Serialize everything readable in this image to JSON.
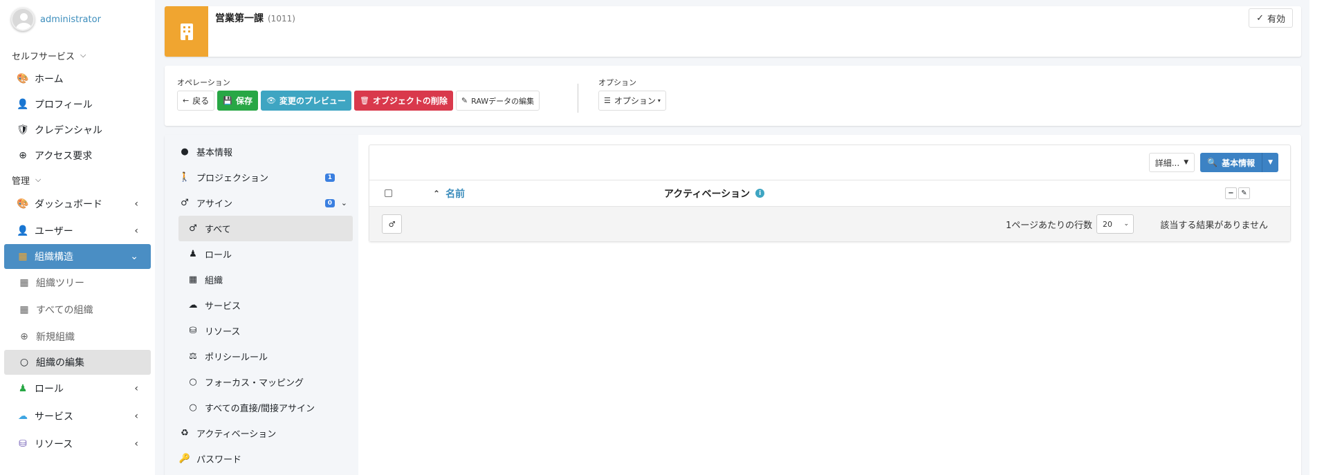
{
  "user": {
    "name": "administrator"
  },
  "sidebar": {
    "self_service_header": "セルフサービス",
    "self_service": [
      {
        "label": "ホーム",
        "icon": "palette-icon"
      },
      {
        "label": "プロフィール",
        "icon": "user-icon"
      },
      {
        "label": "クレデンシャル",
        "icon": "shield-icon"
      },
      {
        "label": "アクセス要求",
        "icon": "plus-circle-icon"
      }
    ],
    "admin_header": "管理",
    "admin": [
      {
        "label": "ダッシュボード",
        "icon": "palette-icon"
      },
      {
        "label": "ユーザー",
        "icon": "user-icon"
      },
      {
        "label": "組織構造",
        "icon": "building-icon"
      },
      {
        "label": "組織ツリー",
        "icon": "building-icon"
      },
      {
        "label": "すべての組織",
        "icon": "building-icon"
      },
      {
        "label": "新規組織",
        "icon": "plus-circle-icon"
      },
      {
        "label": "組織の編集",
        "icon": "circle-icon"
      },
      {
        "label": "ロール",
        "icon": "role-icon"
      },
      {
        "label": "サービス",
        "icon": "cloud-icon"
      },
      {
        "label": "リソース",
        "icon": "database-icon"
      }
    ]
  },
  "org": {
    "title": "営業第一課",
    "code": "(1011)",
    "status_label": "有効"
  },
  "operations": {
    "label": "オペレーション",
    "back": "戻る",
    "save": "保存",
    "preview": "変更のプレビュー",
    "delete": "オブジェクトの削除",
    "raw_edit": "RAWデータの編集"
  },
  "options": {
    "label": "オプション",
    "button": "オプション"
  },
  "detail_nav": {
    "basic": "基本情報",
    "projection": "プロジェクション",
    "projection_count": "1",
    "assign": "アサイン",
    "assign_count": "0",
    "all": "すべて",
    "role": "ロール",
    "org": "組織",
    "service": "サービス",
    "resource": "リソース",
    "policy_rule": "ポリシールール",
    "focus_mapping": "フォーカス・マッピング",
    "all_direct_indirect": "すべての直接/間接アサイン",
    "activation": "アクティベーション",
    "password": "パスワード"
  },
  "table": {
    "detail_dropdown": "詳細...",
    "search_button": "基本情報",
    "col_name": "名前",
    "col_activation": "アクティベーション",
    "rows_per_page_label": "1ページあたりの行数",
    "rows_per_page": "20",
    "no_results": "該当する結果がありません"
  },
  "colors": {
    "accent": "#4a8ec4",
    "org_icon_bg": "#f0a530",
    "save": "#28a745",
    "preview": "#3ea5c2",
    "delete": "#d9394c"
  }
}
